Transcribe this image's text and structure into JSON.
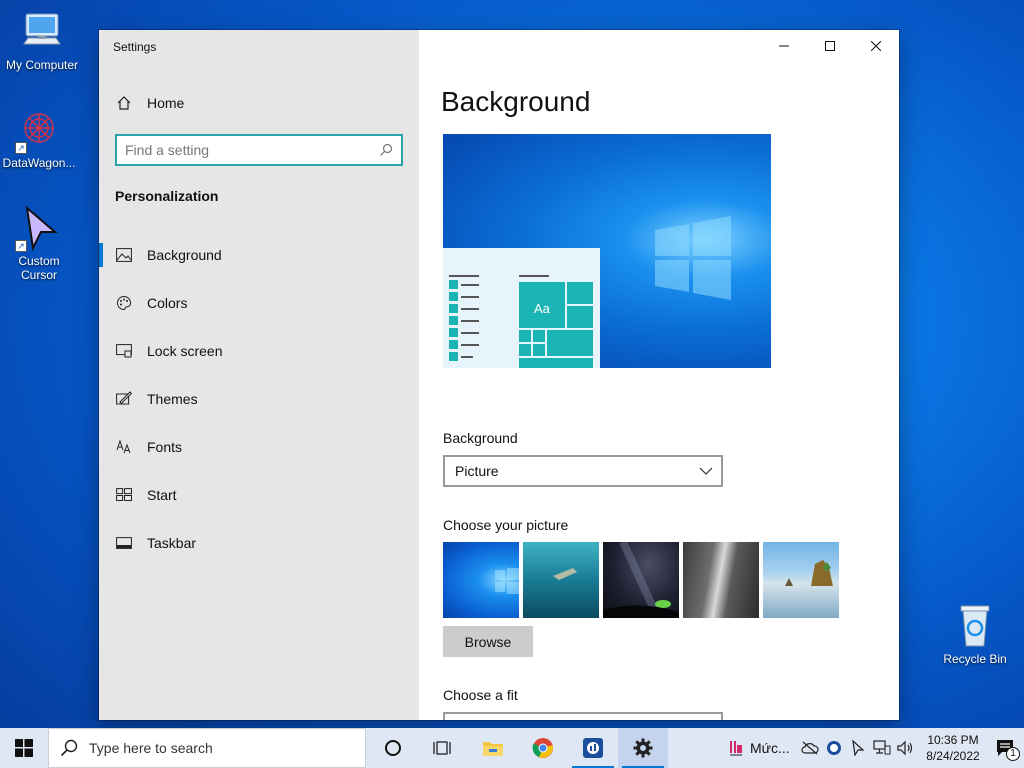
{
  "desktop": {
    "icons": [
      {
        "label": "My Computer"
      },
      {
        "label": "DataWagon..."
      },
      {
        "label": "Custom Cursor"
      },
      {
        "label": "Recycle Bin"
      }
    ]
  },
  "window": {
    "title": "Settings",
    "controls": {
      "minimize": "minimize",
      "maximize": "maximize",
      "close": "close"
    }
  },
  "sidebar": {
    "home_label": "Home",
    "search_placeholder": "Find a setting",
    "section_heading": "Personalization",
    "items": [
      {
        "label": "Background",
        "icon": "picture-icon",
        "active": true
      },
      {
        "label": "Colors",
        "icon": "palette-icon"
      },
      {
        "label": "Lock screen",
        "icon": "lock-screen-icon"
      },
      {
        "label": "Themes",
        "icon": "themes-icon"
      },
      {
        "label": "Fonts",
        "icon": "fonts-icon"
      },
      {
        "label": "Start",
        "icon": "start-icon"
      },
      {
        "label": "Taskbar",
        "icon": "taskbar-icon"
      }
    ]
  },
  "main": {
    "title": "Background",
    "preview": {
      "sample_text": "Aa"
    },
    "background_label": "Background",
    "background_value": "Picture",
    "choose_picture_label": "Choose your picture",
    "pictures": [
      "windows-light",
      "underwater-swimmer",
      "night-sky-tent",
      "rock-waterfall",
      "beach-rocks"
    ],
    "browse_label": "Browse",
    "fit_label": "Choose a fit"
  },
  "taskbar": {
    "search_placeholder": "Type here to search",
    "apps": [
      "task-view",
      "file-explorer",
      "chrome",
      "app-blue",
      "settings"
    ],
    "tray_text": "Mức...",
    "time": "10:36 PM",
    "date": "8/24/2022",
    "notification_count": "1"
  },
  "colors": {
    "accent": "#0078d4",
    "search_border": "#2aa3ad",
    "sidebar_bg": "#e6e6e6",
    "taskbar_bg": "#dfe7f4",
    "preview_tile": "#1ab4b4"
  }
}
